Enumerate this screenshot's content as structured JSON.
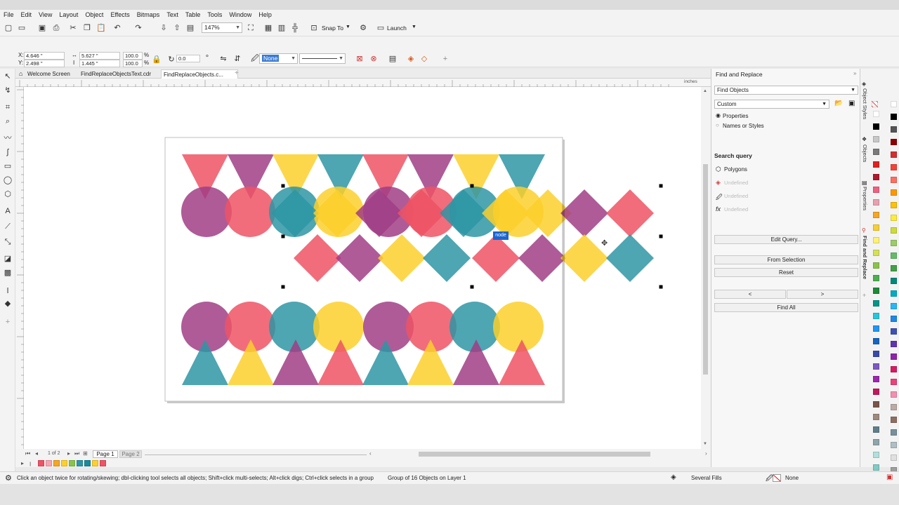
{
  "menu": [
    "File",
    "Edit",
    "View",
    "Layout",
    "Object",
    "Effects",
    "Bitmaps",
    "Text",
    "Table",
    "Tools",
    "Window",
    "Help"
  ],
  "toolbar": {
    "zoom": "147%",
    "snap_to": "Snap To",
    "launch": "Launch"
  },
  "properties": {
    "x": "4.646 \"",
    "y": "2.498 \"",
    "width": "5.627 \"",
    "height": "1.445 \"",
    "scale_x": "100.0",
    "scale_y": "100.0",
    "percent": "%",
    "angle": "0.0",
    "outline": "None"
  },
  "tabs": [
    "Welcome Screen",
    "FindReplaceObjectsText.cdr",
    "FindReplaceObjects.c..."
  ],
  "ruler_unit": "inches",
  "canvas": {
    "tooltip": "node"
  },
  "pages": {
    "counter": "1 of 2",
    "page1": "Page 1",
    "page2": "Page 2"
  },
  "docker": {
    "title": "Find and Replace",
    "mode": "Find Objects",
    "preset": "Custom",
    "radio_properties": "Properties",
    "radio_names": "Names or Styles",
    "search_query_label": "Search query",
    "query_polygons": "Polygons",
    "query_undefined_1": "Undefined",
    "query_undefined_2": "Undefined",
    "query_undefined_3": "Undefined",
    "edit_query": "Edit Query...",
    "from_selection": "From Selection",
    "reset": "Reset",
    "prev": "<",
    "next": ">",
    "find_all": "Find All"
  },
  "docker_tabs": [
    "Object Styles",
    "Objects",
    "Properties",
    "Find and Replace"
  ],
  "status": {
    "hint": "Click an object twice for rotating/skewing; dbl-clicking tool selects all objects; Shift+click multi-selects; Alt+click digs; Ctrl+click selects in a group",
    "selection": "Group of 16 Objects on Layer 1",
    "fill": "Several Fills",
    "outline": "None"
  },
  "colors": {
    "pink": "#ef5365",
    "purple": "#a13e86",
    "yellow": "#fdd02c",
    "teal": "#2e96a4",
    "selection": "#1a66d2"
  },
  "palette": [
    "#ffffff",
    "#000000",
    "#c8c8c8",
    "#7a7a7a",
    "#e02020",
    "#b01830",
    "#f06080",
    "#e8a0b0",
    "#f5a623",
    "#f7d030",
    "#fff176",
    "#d4e157",
    "#8bc34a",
    "#4caf50",
    "#1b8a3a",
    "#009688",
    "#26c6da",
    "#2196f3",
    "#1565c0",
    "#3949ab",
    "#7e57c2",
    "#9c27b0",
    "#c2185b",
    "#795548",
    "#a1887f",
    "#607d8b",
    "#90a4ae",
    "#b2dfdb",
    "#80cbc4",
    "#4db6ac"
  ],
  "palette2": [
    "#ffffff",
    "#000000",
    "#555555",
    "#8b0000",
    "#d32f2f",
    "#f44336",
    "#ff6f61",
    "#ff9800",
    "#ffc107",
    "#ffeb3b",
    "#cddc39",
    "#9ccc65",
    "#66bb6a",
    "#43a047",
    "#00897b",
    "#00acc1",
    "#29b6f6",
    "#1e88e5",
    "#3f51b5",
    "#5e35b1",
    "#8e24aa",
    "#d81b60",
    "#ec407a",
    "#f48fb1",
    "#bcaaa4",
    "#8d6e63",
    "#78909c",
    "#b0bec5",
    "#e0e0e0",
    "#9e9e9e"
  ],
  "recent_swatches": [
    "#ef5365",
    "#f7a6b0",
    "#f5a623",
    "#fdd02c",
    "#8bc34a",
    "#2e96a4",
    "#1b8a9a",
    "#fdd02c",
    "#ef5365"
  ]
}
